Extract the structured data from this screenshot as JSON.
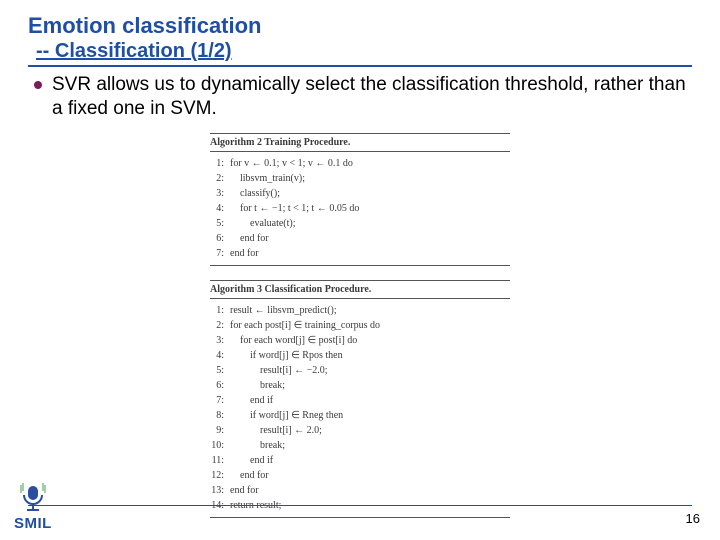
{
  "title": "Emotion classification",
  "subtitle": "-- Classification (1/2)",
  "bullet": "SVR allows us to dynamically select the classification threshold, rather than a fixed one in SVM.",
  "algo2": {
    "title": "Algorithm 2 Training Procedure.",
    "lines": [
      {
        "n": "1:",
        "c": "for v ← 0.1; v < 1; v ← 0.1 do"
      },
      {
        "n": "2:",
        "c": "    libsvm_train(v);"
      },
      {
        "n": "3:",
        "c": "    classify();"
      },
      {
        "n": "4:",
        "c": "    for t ← −1; t < 1; t ← 0.05 do"
      },
      {
        "n": "5:",
        "c": "        evaluate(t);"
      },
      {
        "n": "6:",
        "c": "    end for"
      },
      {
        "n": "7:",
        "c": "end for"
      }
    ]
  },
  "algo3": {
    "title": "Algorithm 3 Classification Procedure.",
    "lines": [
      {
        "n": "1:",
        "c": "result ← libsvm_predict();"
      },
      {
        "n": "2:",
        "c": "for each post[i] ∈ training_corpus do"
      },
      {
        "n": "3:",
        "c": "    for each word[j] ∈ post[i] do"
      },
      {
        "n": "4:",
        "c": "        if word[j] ∈ Rpos then"
      },
      {
        "n": "5:",
        "c": "            result[i] ← −2.0;"
      },
      {
        "n": "6:",
        "c": "            break;"
      },
      {
        "n": "7:",
        "c": "        end if"
      },
      {
        "n": "8:",
        "c": "        if word[j] ∈ Rneg then"
      },
      {
        "n": "9:",
        "c": "            result[i] ← 2.0;"
      },
      {
        "n": "10:",
        "c": "            break;"
      },
      {
        "n": "11:",
        "c": "        end if"
      },
      {
        "n": "12:",
        "c": "    end for"
      },
      {
        "n": "13:",
        "c": "end for"
      },
      {
        "n": "14:",
        "c": "return result;"
      }
    ]
  },
  "logo": "SMIL",
  "pageNum": "16"
}
